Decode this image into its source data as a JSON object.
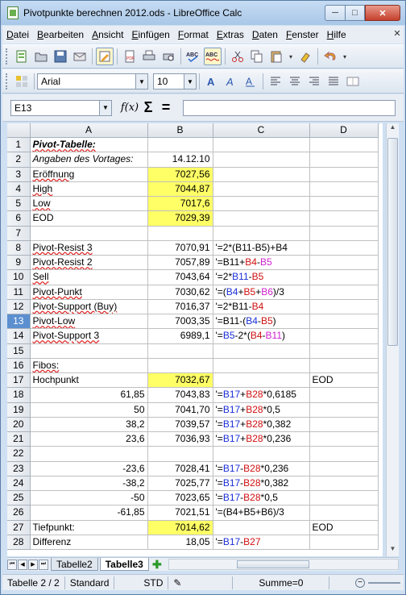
{
  "window": {
    "title": "Pivotpunkte berechnen 2012.ods - LibreOffice Calc",
    "minimize": "─",
    "maximize": "□",
    "close": "✕"
  },
  "menu": [
    "Datei",
    "Bearbeiten",
    "Ansicht",
    "Einfügen",
    "Format",
    "Extras",
    "Daten",
    "Fenster",
    "Hilfe"
  ],
  "menu_close": "✕",
  "toolbar2": {
    "font": "Arial",
    "size": "10"
  },
  "formula": {
    "cell_ref": "E13",
    "fx": "f(x)",
    "sigma": "Σ",
    "equals": "=",
    "content": ""
  },
  "columns": [
    "A",
    "B",
    "C",
    "D"
  ],
  "rows": [
    {
      "n": "1",
      "a": "Pivot-Tabelle:",
      "b": "",
      "c": "",
      "d": ""
    },
    {
      "n": "2",
      "a": "Angaben des Vortages:",
      "b": "14.12.10",
      "c": "",
      "d": ""
    },
    {
      "n": "3",
      "a": "Eröffnung",
      "b": "7027,56",
      "c": "",
      "d": ""
    },
    {
      "n": "4",
      "a": "High",
      "b": "7044,87",
      "c": "",
      "d": ""
    },
    {
      "n": "5",
      "a": "Low",
      "b": "7017,6",
      "c": "",
      "d": ""
    },
    {
      "n": "6",
      "a": "EOD",
      "b": "7029,39",
      "c": "",
      "d": ""
    },
    {
      "n": "7",
      "a": "",
      "b": "",
      "c": "",
      "d": ""
    },
    {
      "n": "8",
      "a": "Pivot-Resist 3",
      "b": "7070,91",
      "c": "'=2*(B11-B5)+B4",
      "d": ""
    },
    {
      "n": "9",
      "a": "Pivot-Resist 2",
      "b": "7057,89",
      "c": "",
      "d": ""
    },
    {
      "n": "10",
      "a": "Sell",
      "b": "7043,64",
      "c": "",
      "d": ""
    },
    {
      "n": "11",
      "a": "Pivot-Punkt",
      "b": "7030,62",
      "c": "",
      "d": ""
    },
    {
      "n": "12",
      "a": "Pivot-Support (Buy)",
      "b": "7016,37",
      "c": "",
      "d": ""
    },
    {
      "n": "13",
      "a": "Pivot-Low",
      "b": "7003,35",
      "c": "",
      "d": ""
    },
    {
      "n": "14",
      "a": "Pivot-Support 3",
      "b": "6989,1",
      "c": "",
      "d": ""
    },
    {
      "n": "15",
      "a": "",
      "b": "",
      "c": "",
      "d": ""
    },
    {
      "n": "16",
      "a": "Fibos:",
      "b": "",
      "c": "",
      "d": ""
    },
    {
      "n": "17",
      "a": "Hochpunkt",
      "b": "7032,67",
      "c": "",
      "d": "EOD"
    },
    {
      "n": "18",
      "a": "61,85",
      "b": "7043,83",
      "c": "",
      "d": ""
    },
    {
      "n": "19",
      "a": "50",
      "b": "7041,70",
      "c": "",
      "d": ""
    },
    {
      "n": "20",
      "a": "38,2",
      "b": "7039,57",
      "c": "",
      "d": ""
    },
    {
      "n": "21",
      "a": "23,6",
      "b": "7036,93",
      "c": "",
      "d": ""
    },
    {
      "n": "22",
      "a": "",
      "b": "",
      "c": "",
      "d": ""
    },
    {
      "n": "23",
      "a": "-23,6",
      "b": "7028,41",
      "c": "",
      "d": ""
    },
    {
      "n": "24",
      "a": "-38,2",
      "b": "7025,77",
      "c": "",
      "d": ""
    },
    {
      "n": "25",
      "a": "-50",
      "b": "7023,65",
      "c": "",
      "d": ""
    },
    {
      "n": "26",
      "a": "-61,85",
      "b": "7021,51",
      "c": "'=(B4+B5+B6)/3",
      "d": ""
    },
    {
      "n": "27",
      "a": "Tiefpunkt:",
      "b": "7014,62",
      "c": "",
      "d": "EOD"
    },
    {
      "n": "28",
      "a": "Differenz",
      "b": "18,05",
      "c": "",
      "d": ""
    }
  ],
  "formulas": {
    "r9": [
      "'=B11+",
      "B4",
      "-",
      "B5"
    ],
    "r10": [
      "'=2*",
      "B11",
      "-",
      "B5"
    ],
    "r11": [
      "'=(",
      "B4",
      "+",
      "B5",
      "+",
      "B6",
      ")/3"
    ],
    "r12": [
      "'=2*B11-",
      "B4"
    ],
    "r13": [
      "'=B11-(",
      "B4",
      "-",
      "B5",
      ")"
    ],
    "r14": [
      "'=",
      "B5",
      "-2*(",
      "B4",
      "-",
      "B11",
      ")"
    ],
    "r18": [
      "'=",
      "B17",
      "+",
      "B28",
      "*0,6185"
    ],
    "r19": [
      "'=",
      "B17",
      "+",
      "B28",
      "*0,5"
    ],
    "r20": [
      "'=",
      "B17",
      "+",
      "B28",
      "*0,382"
    ],
    "r21": [
      "'=",
      "B17",
      "+",
      "B28",
      "*0,236"
    ],
    "r23": [
      "'=",
      "B17",
      "-",
      "B28",
      "*0,236"
    ],
    "r24": [
      "'=",
      "B17",
      "-",
      "B28",
      "*0,382"
    ],
    "r25": [
      "'=",
      "B17",
      "-",
      "B28",
      "*0,5"
    ],
    "r28": [
      "'=",
      "B17",
      "-",
      "B27"
    ]
  },
  "tabs": [
    "Tabelle2",
    "Tabelle3"
  ],
  "active_tab": "Tabelle3",
  "status": {
    "sheet": "Tabelle 2 / 2",
    "style": "Standard",
    "mode": "STD",
    "sum": "Summe=0"
  }
}
